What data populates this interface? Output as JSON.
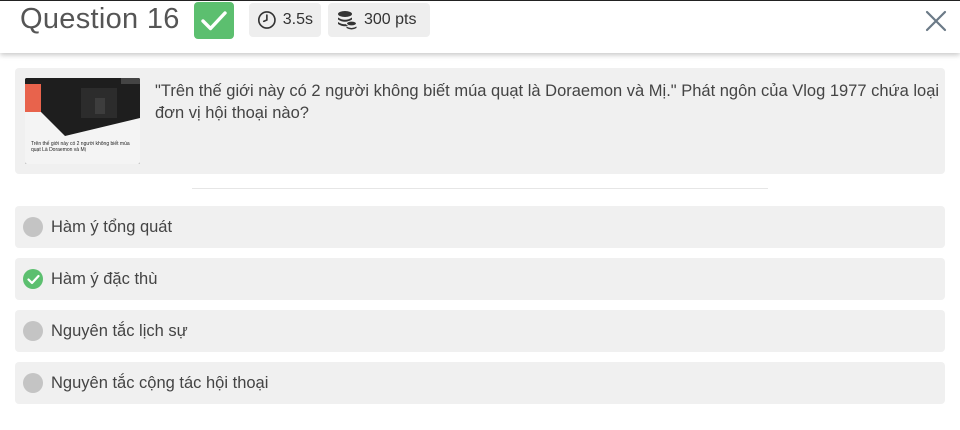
{
  "header": {
    "question_title": "Question 16",
    "time": "3.5s",
    "points": "300 pts",
    "correct_color": "#5cbf6f",
    "icons": [
      "check-icon",
      "timer-icon",
      "coins-icon",
      "close-icon"
    ]
  },
  "question": {
    "text": "\"Trên thế giới này có 2 người không biết múa quạt là Doraemon và Mị.\" Phát ngôn của Vlog 1977 chứa loại đơn vị hội thoại nào?",
    "thumbnail_caption": "Trên thế giới này có 2 người không biết múa quạt Là Doraemon và Mị"
  },
  "options": [
    {
      "label": "Hàm ý tổng quát",
      "correct": false
    },
    {
      "label": "Hàm ý đặc thù",
      "correct": true
    },
    {
      "label": "Nguyên tắc lịch sự",
      "correct": false
    },
    {
      "label": "Nguyên tắc cộng tác hội thoại",
      "correct": false
    }
  ]
}
